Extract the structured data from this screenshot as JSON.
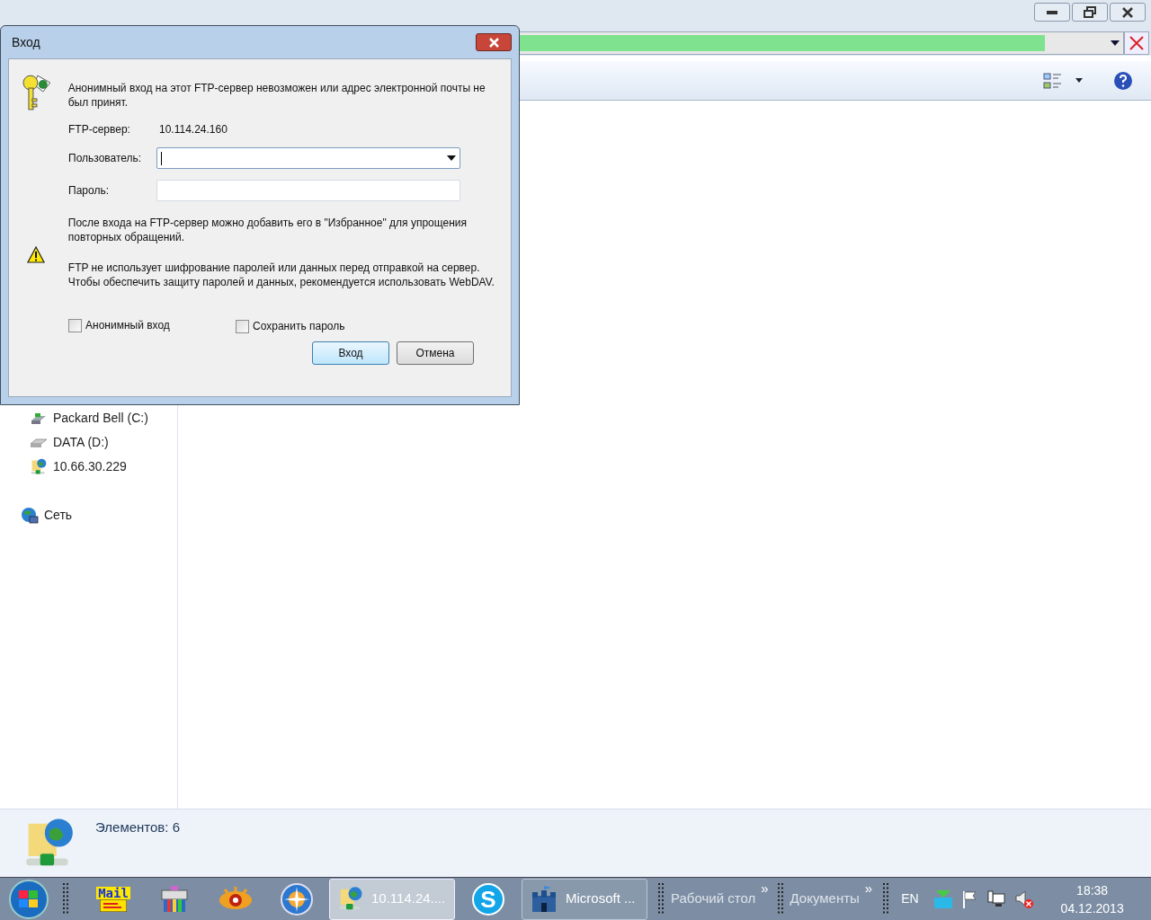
{
  "explorer": {
    "address_bar": {
      "level": 0.93
    },
    "nav_items": [
      {
        "label": "Packard Bell (C:)",
        "kind": "drive"
      },
      {
        "label": "DATA (D:)",
        "kind": "disk"
      },
      {
        "label": "10.66.30.229",
        "kind": "ftp"
      }
    ],
    "network": {
      "label": "Сеть"
    },
    "details": {
      "text": "Элементов: 6"
    }
  },
  "dialog": {
    "title": "Вход",
    "message": "Анонимный вход на этот FTP-сервер невозможен или адрес электронной почты не был принят.",
    "server_label": "FTP-сервер:",
    "server_value": "10.114.24.160",
    "user_label": "Пользователь:",
    "password_label": "Пароль:",
    "note": "После входа на FTP-сервер можно добавить его в \"Избранное\" для упрощения повторных обращений.",
    "warning": "FTP не использует шифрование паролей или данных перед отправкой на сервер. Чтобы обеспечить защиту паролей и данных, рекомендуется использовать WebDAV.",
    "checkboxes": [
      {
        "label": "Анонимный вход",
        "checked": false
      },
      {
        "label": "Сохранить пароль",
        "checked": false
      }
    ],
    "buttons": [
      {
        "label": "Вход",
        "default": true
      },
      {
        "label": "Отмена",
        "default": false
      }
    ]
  },
  "taskbar": {
    "items": [
      {
        "kind": "mail",
        "label": "Mail"
      },
      {
        "kind": "printer"
      },
      {
        "kind": "eye"
      },
      {
        "kind": "compass"
      },
      {
        "kind": "ftp",
        "label": "10.114.24....",
        "selected": true
      },
      {
        "kind": "skype",
        "label": "S"
      },
      {
        "kind": "castle",
        "label": "Microsoft ...",
        "selected": false
      }
    ],
    "toolbars": [
      {
        "label": "Рабочий стол",
        "chevron": "»"
      },
      {
        "label": "Документы",
        "chevron": "»"
      }
    ],
    "language": "EN",
    "clock": {
      "time": "18:38",
      "date": "04.12.2013"
    }
  }
}
